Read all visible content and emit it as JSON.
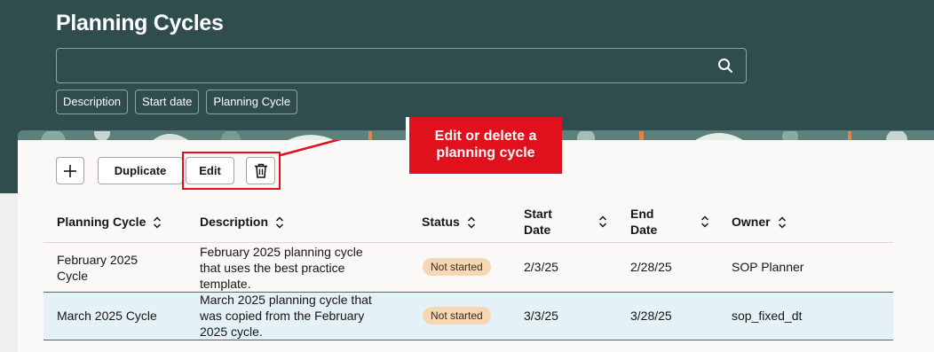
{
  "page": {
    "title": "Planning Cycles"
  },
  "search": {
    "placeholder": "",
    "icon": "search-icon"
  },
  "filters": [
    "Description",
    "Start date",
    "Planning Cycle"
  ],
  "toolbar": {
    "add_icon": "plus-icon",
    "duplicate_label": "Duplicate",
    "edit_label": "Edit",
    "delete_icon": "trash-icon"
  },
  "callout": {
    "line1": "Edit or delete a",
    "line2": "planning cycle"
  },
  "table": {
    "headers": {
      "planning_cycle": "Planning Cycle",
      "description": "Description",
      "status": "Status",
      "start_date_1": "Start",
      "start_date_2": "Date",
      "end_date_1": "End",
      "end_date_2": "Date",
      "owner": "Owner"
    },
    "rows": [
      {
        "cycle_1": "February 2025",
        "cycle_2": "Cycle",
        "desc_1": "February 2025 planning cycle",
        "desc_2": "that uses the best practice",
        "desc_3": "template.",
        "status": "Not started",
        "start": "2/3/25",
        "end": "2/28/25",
        "owner": "SOP Planner"
      },
      {
        "cycle_1": "March 2025 Cycle",
        "desc_1": "March 2025 planning cycle that",
        "desc_2": "was copied from the February",
        "desc_3": "2025 cycle.",
        "status": "Not started",
        "start": "3/3/25",
        "end": "3/28/25",
        "owner": "sop_fixed_dt"
      }
    ]
  },
  "colors": {
    "header_bg": "#2f4d4e",
    "callout": "#e0101c",
    "badge": "#f6d7b3",
    "selected_row": "#e4f1f7"
  }
}
